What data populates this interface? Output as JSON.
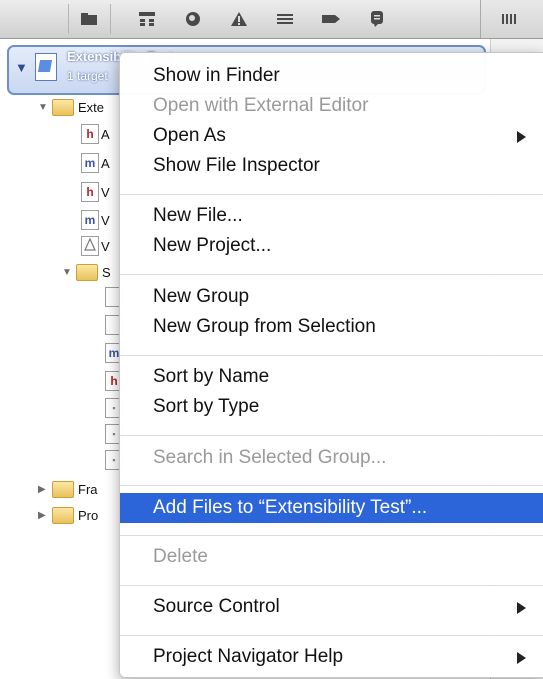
{
  "toolbar": {
    "icons": [
      "folder-icon",
      "hierarchy-icon",
      "search-icon",
      "warning-icon",
      "list-icon",
      "tag-icon",
      "speech-bubble-icon"
    ],
    "right_icon": "grid-icon"
  },
  "navigator": {
    "project": {
      "name": "Extensibility Test",
      "subtitle": "1 target"
    },
    "tree": {
      "group1": "Exte",
      "group2": "S",
      "frameworks": "Fra",
      "products": "Pro",
      "file_letters": [
        "h",
        "m",
        "h",
        "m"
      ],
      "file_letters_2": [
        "m",
        "h"
      ],
      "file_prefixes": [
        "A",
        "A",
        "V",
        "V",
        "V"
      ]
    }
  },
  "context_menu": {
    "items": [
      {
        "label": "Show in Finder",
        "enabled": true
      },
      {
        "label": "Open with External Editor",
        "enabled": false
      },
      {
        "label": "Open As",
        "enabled": true,
        "submenu": true
      },
      {
        "label": "Show File Inspector",
        "enabled": true
      },
      {
        "label": "New File...",
        "enabled": true
      },
      {
        "label": "New Project...",
        "enabled": true
      },
      {
        "label": "New Group",
        "enabled": true
      },
      {
        "label": "New Group from Selection",
        "enabled": true
      },
      {
        "label": "Sort by Name",
        "enabled": true
      },
      {
        "label": "Sort by Type",
        "enabled": true
      },
      {
        "label": "Search in Selected Group...",
        "enabled": false
      },
      {
        "label": "Add Files to “Extensibility Test”...",
        "enabled": true,
        "highlighted": true
      },
      {
        "label": "Delete",
        "enabled": false
      },
      {
        "label": "Source Control",
        "enabled": true,
        "submenu": true
      },
      {
        "label": "Project Navigator Help",
        "enabled": true,
        "submenu": true
      }
    ]
  },
  "colors": {
    "highlight": "#2c64d9",
    "selection_border": "#6f8fc8"
  }
}
